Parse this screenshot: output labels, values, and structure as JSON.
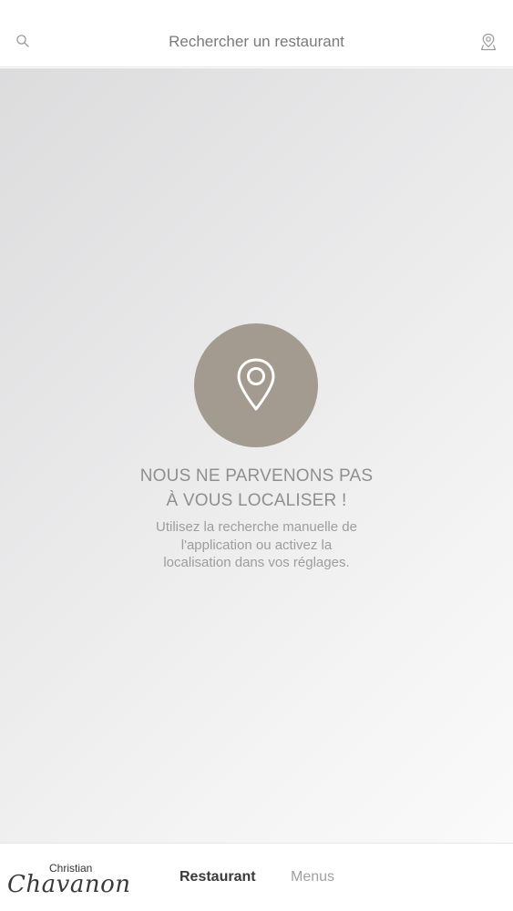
{
  "header": {
    "search_placeholder": "Rechercher un restaurant",
    "search_icon": "search-icon",
    "locate_icon": "location-pin-icon"
  },
  "empty_state": {
    "icon": "location-pin-icon",
    "icon_circle_color": "#a39b90",
    "title_line1": "NOUS NE PARVENONS PAS",
    "title_line2": "À VOUS LOCALISER !",
    "message_line1": "Utilisez la recherche manuelle de",
    "message_line2": "l'application ou activez la",
    "message_line3": "localisation dans vos réglages."
  },
  "footer": {
    "logo_small": "Christian",
    "logo_script": "Chavanon",
    "tabs": [
      {
        "label": "Restaurant",
        "active": true
      },
      {
        "label": "Menus",
        "active": false
      }
    ]
  }
}
